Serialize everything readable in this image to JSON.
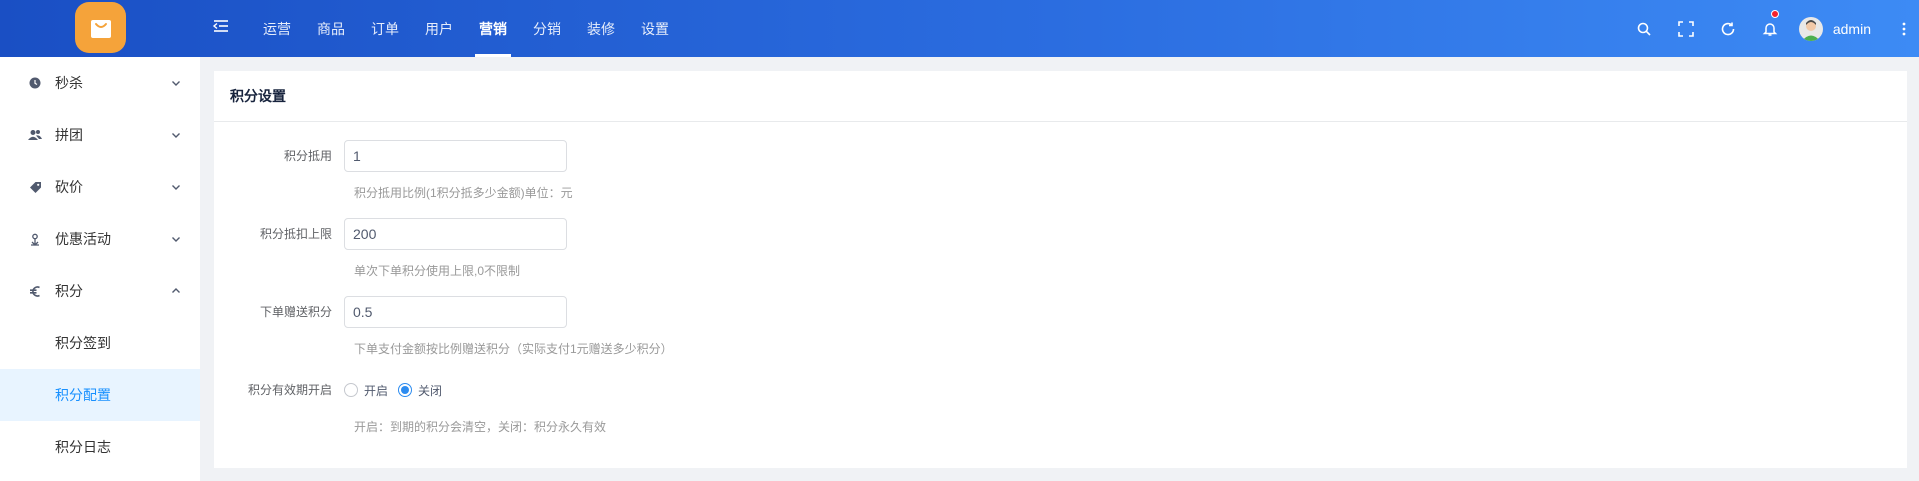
{
  "header": {
    "nav": [
      {
        "label": "运营",
        "active": false
      },
      {
        "label": "商品",
        "active": false
      },
      {
        "label": "订单",
        "active": false
      },
      {
        "label": "用户",
        "active": false
      },
      {
        "label": "营销",
        "active": true
      },
      {
        "label": "分销",
        "active": false
      },
      {
        "label": "装修",
        "active": false
      },
      {
        "label": "设置",
        "active": false
      }
    ],
    "username": "admin",
    "icons": [
      "search-icon",
      "fullscreen-icon",
      "refresh-icon",
      "bell-icon",
      "more-icon"
    ]
  },
  "sidebar": {
    "items": [
      {
        "label": "秒杀",
        "icon": "clock-icon",
        "expanded": false
      },
      {
        "label": "拼团",
        "icon": "group-icon",
        "expanded": false
      },
      {
        "label": "砍价",
        "icon": "tag-icon",
        "expanded": false
      },
      {
        "label": "优惠活动",
        "icon": "gift-icon",
        "expanded": false
      },
      {
        "label": "积分",
        "icon": "euro-icon",
        "expanded": true
      }
    ],
    "sub_items": [
      {
        "label": "积分签到",
        "active": false
      },
      {
        "label": "积分配置",
        "active": true
      },
      {
        "label": "积分日志",
        "active": false
      }
    ]
  },
  "main": {
    "title": "积分设置",
    "fields": [
      {
        "label": "积分抵用",
        "value": "1",
        "hint": "积分抵用比例(1积分抵多少金额)单位：元"
      },
      {
        "label": "积分抵扣上限",
        "value": "200",
        "hint": "单次下单积分使用上限,0不限制"
      },
      {
        "label": "下单赠送积分",
        "value": "0.5",
        "hint": "下单支付金额按比例赠送积分（实际支付1元赠送多少积分）"
      }
    ],
    "expiry": {
      "label": "积分有效期开启",
      "options": [
        {
          "label": "开启",
          "checked": false
        },
        {
          "label": "关闭",
          "checked": true
        }
      ],
      "hint": "开启：到期的积分会清空，关闭：积分永久有效"
    }
  },
  "colors": {
    "primary": "#2d8cf0",
    "header_start": "#1a4fc4",
    "header_end": "#3d8bf5",
    "logo": "#f5a33a",
    "active_sidebar_bg": "#e8f4ff",
    "active_sidebar_text": "#1890ff"
  }
}
